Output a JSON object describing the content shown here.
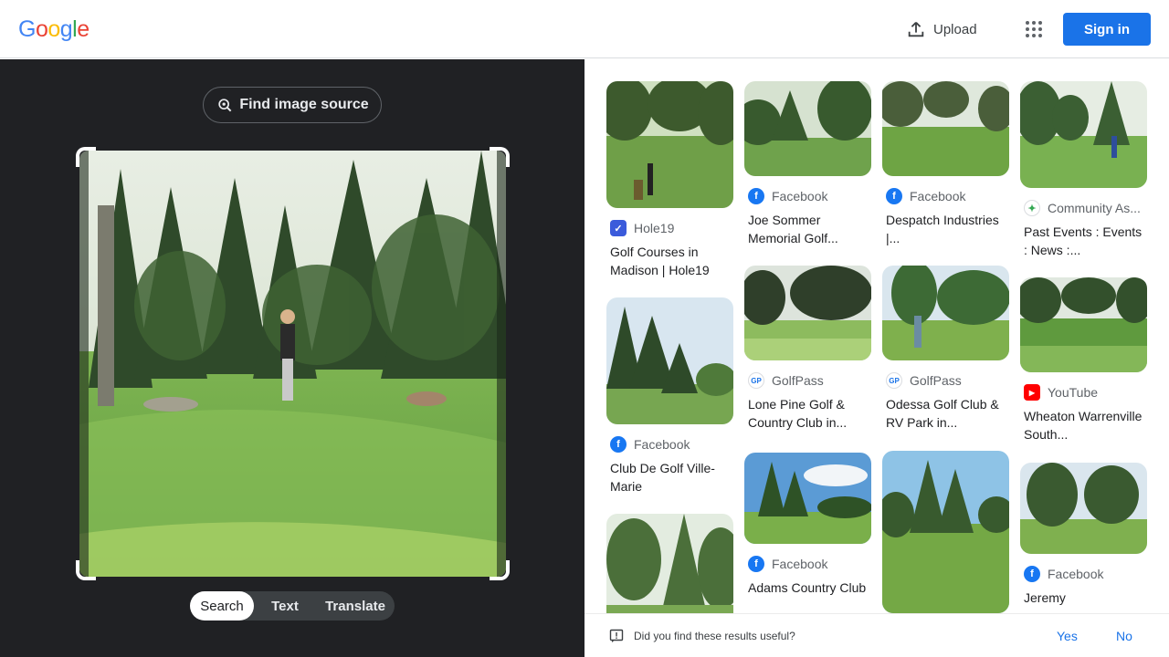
{
  "header": {
    "logo_letters": [
      {
        "ch": "G",
        "color": "#4285f4"
      },
      {
        "ch": "o",
        "color": "#ea4335"
      },
      {
        "ch": "o",
        "color": "#fbbc05"
      },
      {
        "ch": "g",
        "color": "#4285f4"
      },
      {
        "ch": "l",
        "color": "#34a853"
      },
      {
        "ch": "e",
        "color": "#ea4335"
      }
    ],
    "upload_label": "Upload",
    "signin_label": "Sign in"
  },
  "lens": {
    "find_source_label": "Find image source",
    "tabs": [
      {
        "label": "Search",
        "active": true
      },
      {
        "label": "Text",
        "active": false
      },
      {
        "label": "Translate",
        "active": false
      }
    ]
  },
  "results": [
    {
      "source": "Hole19",
      "source_icon": "hole19-icon",
      "title": "Golf Courses in Madison | Hole19"
    },
    {
      "source": "Facebook",
      "source_icon": "facebook-icon",
      "title": "Joe Sommer Memorial Golf..."
    },
    {
      "source": "Facebook",
      "source_icon": "facebook-icon",
      "title": "Despatch Industries |..."
    },
    {
      "source": "Community As...",
      "source_icon": "community-icon",
      "title": "Past Events : Events : News :..."
    },
    {
      "source": "Facebook",
      "source_icon": "facebook-icon",
      "title": "Club De Golf Ville-Marie"
    },
    {
      "source": "GolfPass",
      "source_icon": "golfpass-icon",
      "title": "Lone Pine Golf & Country Club in..."
    },
    {
      "source": "GolfPass",
      "source_icon": "golfpass-icon",
      "title": "Odessa Golf Club & RV Park in..."
    },
    {
      "source": "YouTube",
      "source_icon": "youtube-icon",
      "title": "Wheaton Warrenville South..."
    },
    {
      "source": "Facebook",
      "source_icon": "facebook-icon",
      "title": "Adams Country Club"
    },
    {
      "source": "Facebook",
      "source_icon": "facebook-icon",
      "title": "Jeremy"
    }
  ],
  "feedback": {
    "question": "Did you find these results useful?",
    "yes": "Yes",
    "no": "No"
  },
  "colors": {
    "accent": "#1a73e8",
    "panel_dark": "#202124",
    "grass": "#6aa84f"
  }
}
